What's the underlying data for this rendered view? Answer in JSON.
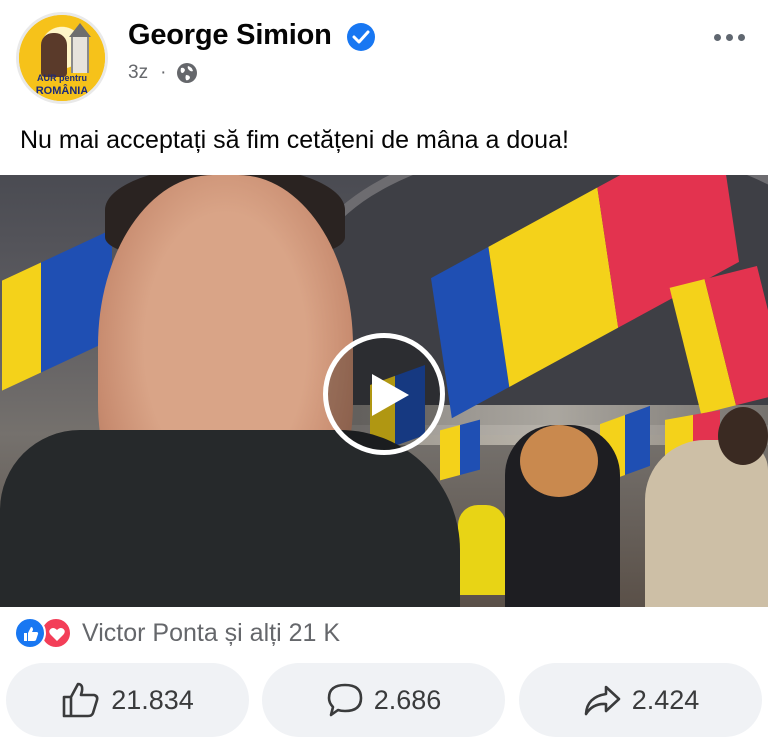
{
  "post": {
    "author": "George Simion",
    "time": "3z",
    "separator": "·",
    "visibility_icon": "globe-icon",
    "verified_icon": "verified-badge-icon",
    "text": "Nu mai acceptați să fim cetățeni de mâna a doua!"
  },
  "avatar": {
    "logo_line1": "AUR pentru",
    "logo_line2": "ROMÂNIA"
  },
  "video": {
    "play_icon": "play-icon"
  },
  "reactions": {
    "icons": [
      "like-reaction-icon",
      "love-reaction-icon"
    ],
    "summary": "Victor Ponta și alți 21 K"
  },
  "actions": {
    "like_count": "21.834",
    "comment_count": "2.686",
    "share_count": "2.424"
  },
  "colors": {
    "facebook_blue": "#1877f2",
    "love_red": "#f33e58",
    "button_bg": "#f0f2f5",
    "secondary_text": "#65676b",
    "flag_blue": "#1f4fb3",
    "flag_yellow": "#f4d21a",
    "flag_red": "#e3334f"
  }
}
